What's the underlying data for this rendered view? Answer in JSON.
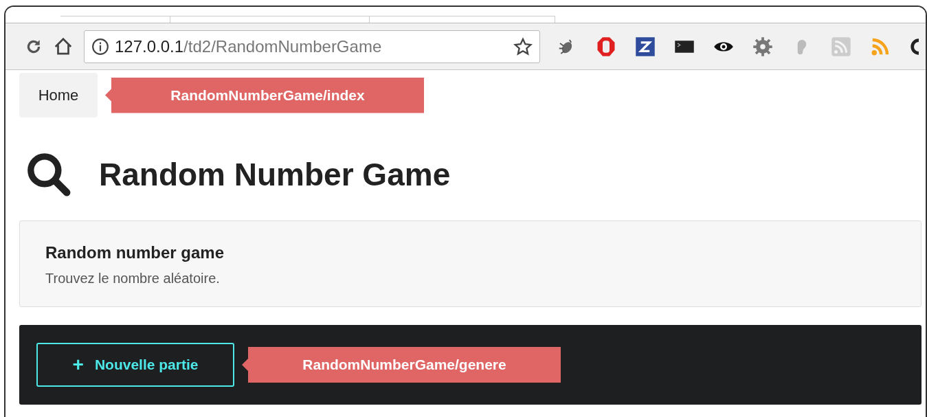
{
  "address_bar": {
    "host": "127.0.0.1",
    "path": "/td2/RandomNumberGame"
  },
  "breadcrumb": {
    "home": "Home",
    "note": "RandomNumberGame/index"
  },
  "heading": "Random Number Game",
  "card": {
    "title": "Random number game",
    "text": "Trouvez le nombre aléatoire."
  },
  "action_bar": {
    "button": {
      "icon": "+",
      "label": "Nouvelle partie"
    },
    "note": "RandomNumberGame/genere"
  }
}
